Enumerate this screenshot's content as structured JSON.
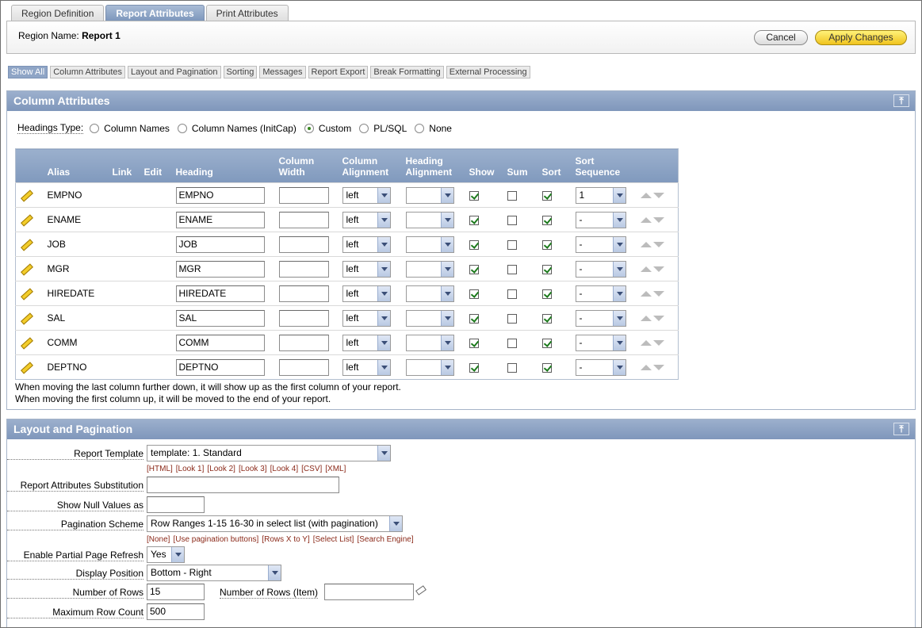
{
  "top_tabs": [
    "Region Definition",
    "Report Attributes",
    "Print Attributes"
  ],
  "region": {
    "label": "Region Name:",
    "name": "Report 1"
  },
  "buttons": {
    "cancel": "Cancel",
    "apply": "Apply Changes"
  },
  "sub_tabs": [
    "Show All",
    "Column Attributes",
    "Layout and Pagination",
    "Sorting",
    "Messages",
    "Report Export",
    "Break Formatting",
    "External Processing"
  ],
  "column_attributes": {
    "title": "Column Attributes",
    "headings_type_label": "Headings Type:",
    "headings_options": [
      "Column Names",
      "Column Names (InitCap)",
      "Custom",
      "PL/SQL",
      "None"
    ],
    "headings_selected": "Custom",
    "columns_header": {
      "alias": "Alias",
      "link": "Link",
      "edit": "Edit",
      "heading": "Heading",
      "width_1": "Column",
      "width_2": "Width",
      "align_1": "Column",
      "align_2": "Alignment",
      "halign_1": "Heading",
      "halign_2": "Alignment",
      "show": "Show",
      "sum": "Sum",
      "sort": "Sort",
      "seq_1": "Sort",
      "seq_2": "Sequence"
    },
    "rows": [
      {
        "alias": "EMPNO",
        "heading": "EMPNO",
        "align": "left",
        "seq": "1"
      },
      {
        "alias": "ENAME",
        "heading": "ENAME",
        "align": "left",
        "seq": "-"
      },
      {
        "alias": "JOB",
        "heading": "JOB",
        "align": "left",
        "seq": "-"
      },
      {
        "alias": "MGR",
        "heading": "MGR",
        "align": "left",
        "seq": "-"
      },
      {
        "alias": "HIREDATE",
        "heading": "HIREDATE",
        "align": "left",
        "seq": "-"
      },
      {
        "alias": "SAL",
        "heading": "SAL",
        "align": "left",
        "seq": "-"
      },
      {
        "alias": "COMM",
        "heading": "COMM",
        "align": "left",
        "seq": "-"
      },
      {
        "alias": "DEPTNO",
        "heading": "DEPTNO",
        "align": "left",
        "seq": "-"
      }
    ],
    "note_1": "When moving the last column further down, it will show up as the first column of your report.",
    "note_2": "When moving the first column up, it will be moved to the end of your report."
  },
  "layout": {
    "title": "Layout and Pagination",
    "report_template_label": "Report Template",
    "report_template_value": "template: 1. Standard",
    "template_links": [
      "[HTML]",
      "[Look 1]",
      "[Look 2]",
      "[Look 3]",
      "[Look 4]",
      "[CSV]",
      "[XML]"
    ],
    "substitution_label": "Report Attributes Substitution",
    "null_values_label": "Show Null Values as",
    "pagination_label": "Pagination Scheme",
    "pagination_value": "Row Ranges 1-15 16-30 in select list (with pagination)",
    "pagination_links": [
      "[None]",
      "[Use pagination buttons]",
      "[Rows X to Y]",
      "[Select List]",
      "[Search Engine]"
    ],
    "ppr_label": "Enable Partial Page Refresh",
    "ppr_value": "Yes",
    "display_position_label": "Display Position",
    "display_position_value": "Bottom - Right",
    "num_rows_label": "Number of Rows",
    "num_rows_value": "15",
    "num_rows_item_label": "Number of Rows (Item)",
    "max_row_label": "Maximum Row Count",
    "max_row_value": "500"
  }
}
